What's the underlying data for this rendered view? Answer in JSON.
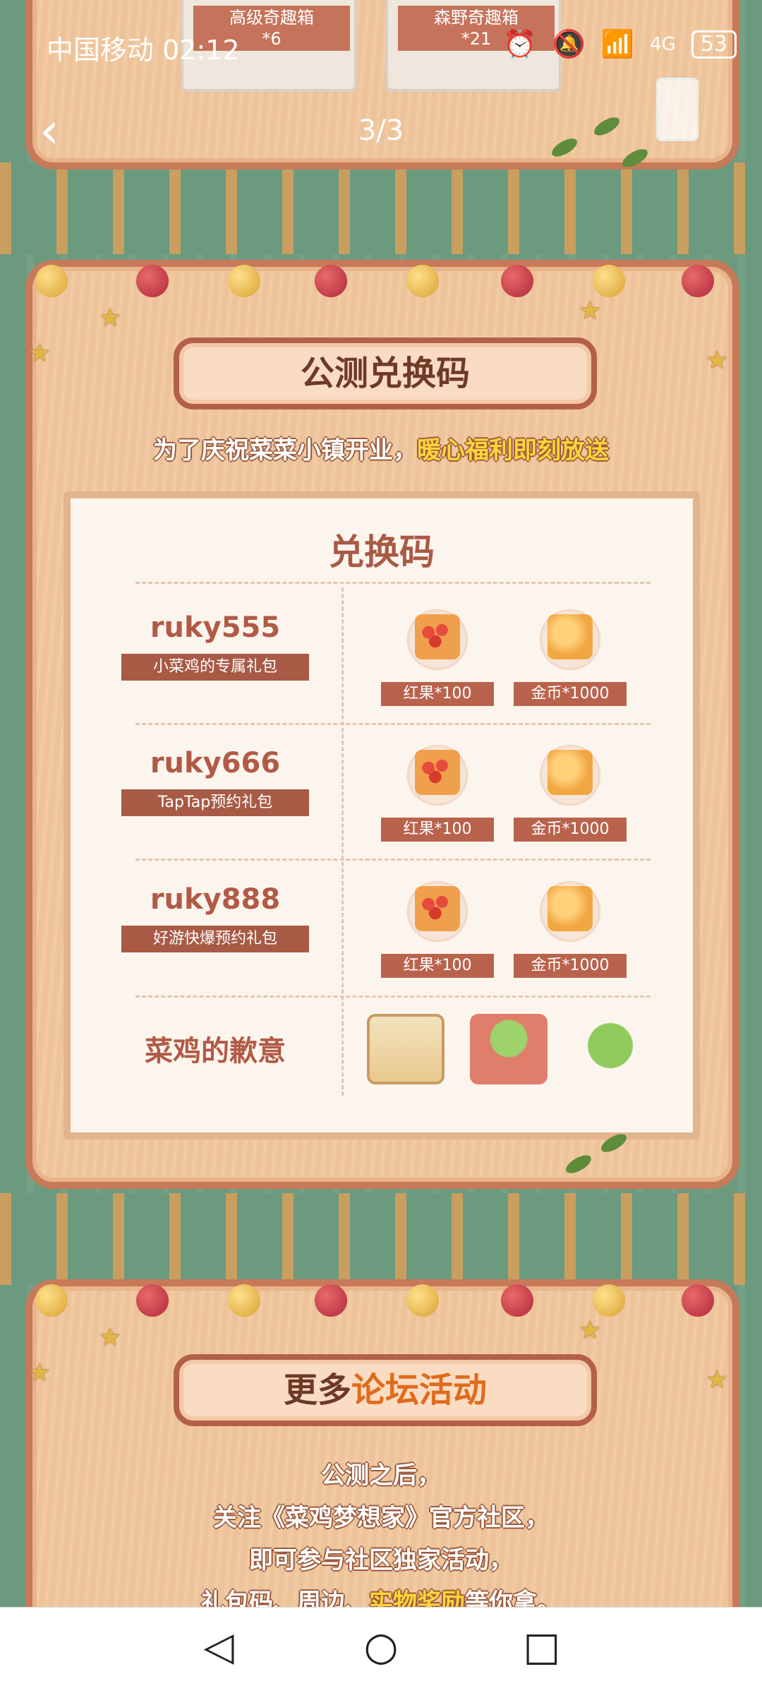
{
  "status_bar": {
    "carrier_time": "中国移动 02:12",
    "network": "4G",
    "battery": "53"
  },
  "topbar": {
    "back_icon": "chevron-left-icon",
    "pager": "3/3"
  },
  "top_tickets": [
    {
      "name": "高级奇趣箱",
      "count": "*6"
    },
    {
      "name": "森野奇趣箱",
      "count": "*21"
    }
  ],
  "redeem_panel": {
    "title": "公测兑换码",
    "subtitle_plain": "为了庆祝菜菜小镇开业，",
    "subtitle_highlight": "暖心福利即刻放送",
    "card_title": "兑换码",
    "codes": [
      {
        "code": "ruky555",
        "desc": "小菜鸡的专属礼包",
        "reward_1": "红果*100",
        "reward_2": "金币*1000"
      },
      {
        "code": "ruky666",
        "desc": "TapTap预约礼包",
        "reward_1": "红果*100",
        "reward_2": "金币*1000"
      },
      {
        "code": "ruky888",
        "desc": "好游快爆预约礼包",
        "reward_1": "红果*100",
        "reward_2": "金币*1000"
      }
    ],
    "apology": "菜鸡的歉意"
  },
  "forum_panel": {
    "title_plain": "更多",
    "title_accent": "论坛活动",
    "lines": [
      "公测之后，",
      "关注《菜鸡梦想家》官方社区，",
      "即可参与社区独家活动，"
    ],
    "last_line_a": "礼包码、周边、",
    "last_line_hl": "实物奖励",
    "last_line_b": "等你拿。"
  },
  "nav": {
    "back": "triangle-back-icon",
    "home": "circle-home-icon",
    "recent": "square-recent-icon"
  },
  "colors": {
    "background": "#6b9a7f",
    "panel": "#f1c79d",
    "accent": "#e06b1d",
    "highlight": "#ffd43a"
  }
}
